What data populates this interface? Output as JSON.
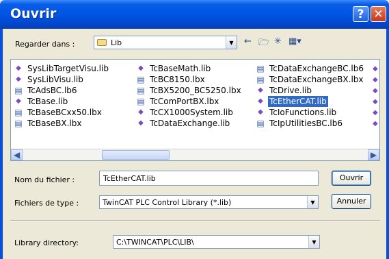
{
  "window": {
    "title": "Ouvrir",
    "help_glyph": "?",
    "close_glyph": "✕"
  },
  "lookin": {
    "label": "Regarder dans :",
    "value": "Lib",
    "icons": [
      "back-arrow-icon",
      "up-folder-icon",
      "new-folder-icon",
      "view-menu-icon"
    ]
  },
  "files": [
    {
      "name": "SysLibTargetVisu.lib",
      "type": "lib"
    },
    {
      "name": "SysLibVisu.lib",
      "type": "lib"
    },
    {
      "name": "TcAdsBC.lb6",
      "type": "lbx"
    },
    {
      "name": "TcBase.lib",
      "type": "lib"
    },
    {
      "name": "TcBaseBCxx50.lbx",
      "type": "lbx"
    },
    {
      "name": "TcBaseBX.lbx",
      "type": "lbx"
    },
    {
      "name": "TcBaseMath.lib",
      "type": "lib"
    },
    {
      "name": "TcBC8150.lbx",
      "type": "lbx"
    },
    {
      "name": "TcBX5200_BC5250.lbx",
      "type": "lbx"
    },
    {
      "name": "TcComPortBX.lbx",
      "type": "lbx"
    },
    {
      "name": "TcCX1000System.lib",
      "type": "lib"
    },
    {
      "name": "TcDataExchange.lib",
      "type": "lib"
    },
    {
      "name": "TcDataExchangeBC.lb6",
      "type": "lbx"
    },
    {
      "name": "TcDataExchangeBX.lbx",
      "type": "lbx"
    },
    {
      "name": "TcDrive.lib",
      "type": "lib"
    },
    {
      "name": "TcEtherCAT.lib",
      "type": "lib",
      "selected": true
    },
    {
      "name": "TcIoFunctions.lib",
      "type": "lib"
    },
    {
      "name": "TcIpUtilitiesBC.lb6",
      "type": "lbx"
    }
  ],
  "filename": {
    "label": "Nom du fichier :",
    "value": "TcEtherCAT.lib"
  },
  "filetype": {
    "label": "Fichiers de type :",
    "value": "TwinCAT PLC Control Library (*.lib)"
  },
  "buttons": {
    "open": "Ouvrir",
    "cancel": "Annuler"
  },
  "libdir": {
    "label": "Library directory:",
    "value": "C:\\TWINCAT\\PLC\\LIB\\"
  }
}
